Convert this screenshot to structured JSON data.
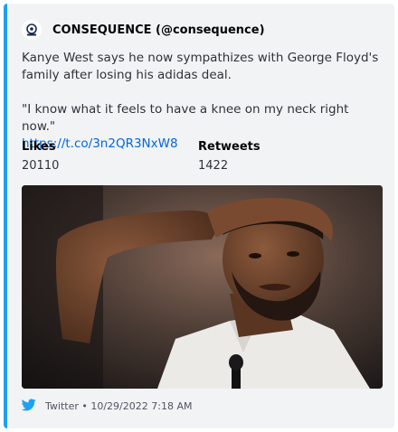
{
  "embed": {
    "accent_color": "#1da1f2",
    "author": {
      "icon": "consequence-logo-icon",
      "name": "CONSEQUENCE (@consequence)"
    },
    "description": {
      "line1": "Kanye West says he now sympathizes with George Floyd's family after losing his adidas deal.",
      "line2": "\"I know what it feels to have a knee on my neck right now.\"",
      "link": "https://t.co/3n2QR3NxW8"
    },
    "fields": [
      {
        "name": "Likes",
        "value": "20110"
      },
      {
        "name": "Retweets",
        "value": "1422"
      }
    ],
    "media": {
      "icon": "photo-of-man-hand-on-head"
    },
    "footer": {
      "icon": "twitter-bird-icon",
      "text": "Twitter • 10/29/2022 7:18 AM"
    }
  }
}
